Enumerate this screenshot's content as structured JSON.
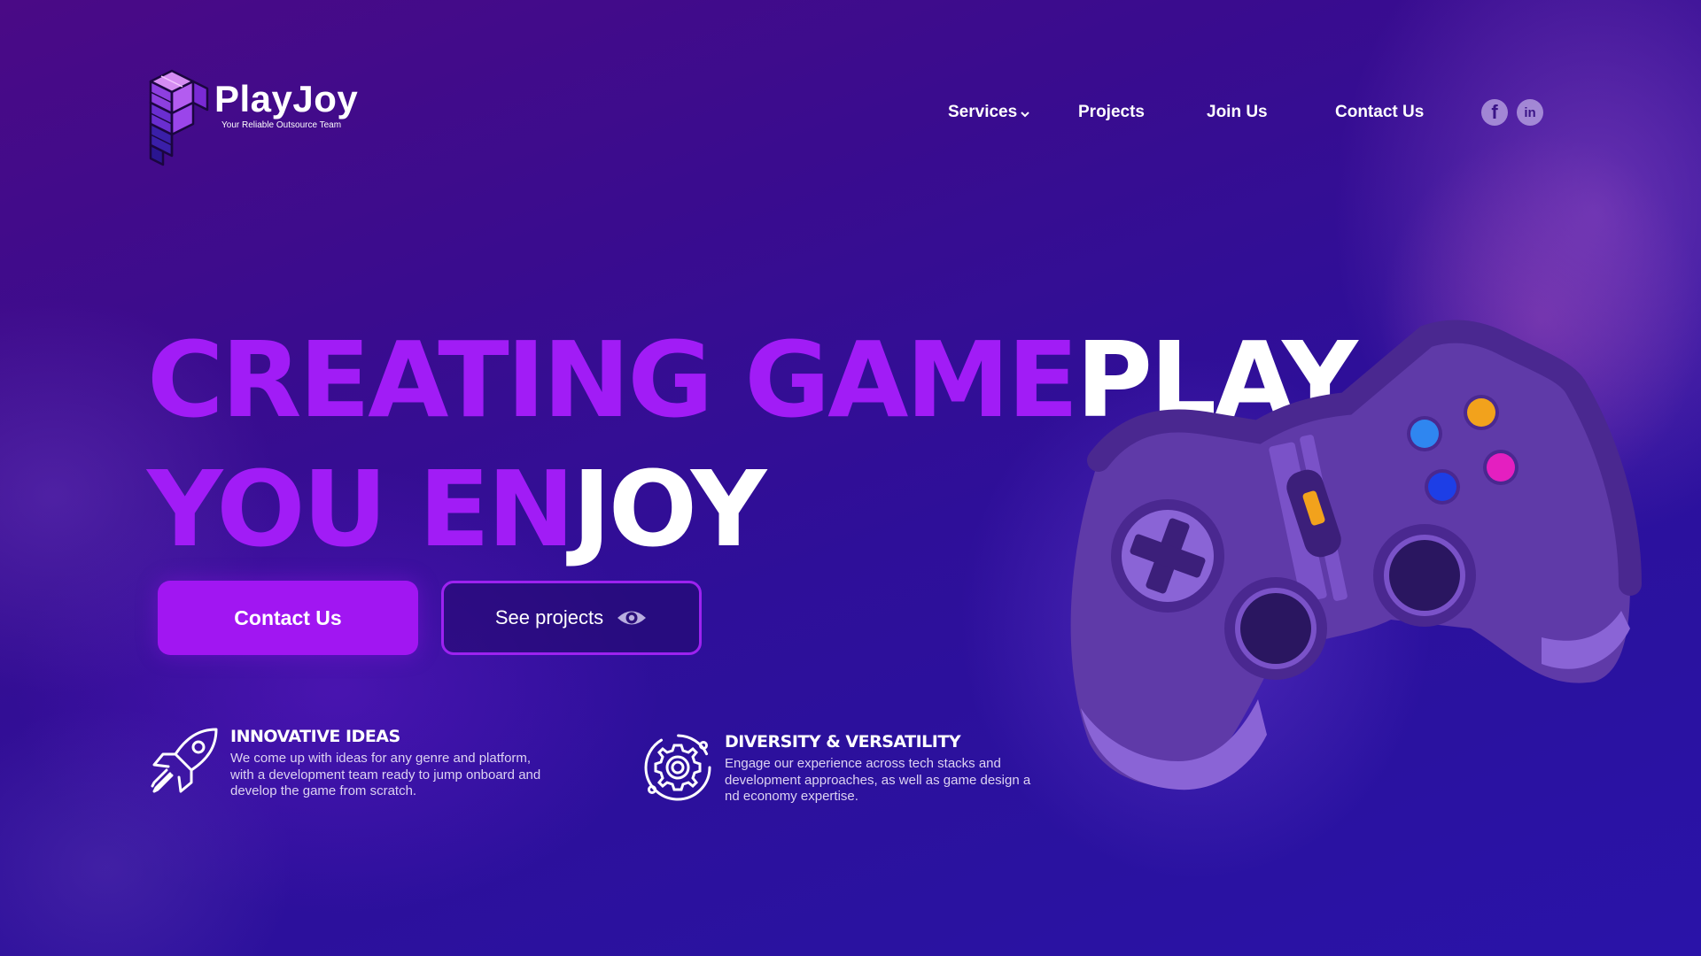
{
  "brand": {
    "name": "PlayJoy",
    "tagline": "Your Reliable  Outsource Team"
  },
  "nav": {
    "services": "Services",
    "projects": "Projects",
    "join_us": "Join Us",
    "contact_us": "Contact Us"
  },
  "social": {
    "facebook": "f",
    "linkedin": "in"
  },
  "hero": {
    "line1_purple": "CREATING GAME",
    "line1_white": "PLAY",
    "line2_purple": "YOU EN",
    "line2_white": "JOY",
    "primary_button": "Contact Us",
    "secondary_button": "See projects"
  },
  "features": [
    {
      "icon": "rocket-icon",
      "title": "INNOVATIVE IDEAS",
      "desc_lines": [
        "We come up with ideas for any genre and platform,",
        "with a development team ready to jump onboard and",
        "develop the game from scratch."
      ]
    },
    {
      "icon": "gear-icon",
      "title": "DIVERSITY & VERSATILITY",
      "desc_lines": [
        "Engage our experience across tech stacks and",
        "development approaches, as well as game design a",
        "nd economy expertise."
      ]
    }
  ],
  "colors": {
    "accent_purple": "#a11cf6",
    "button_purple": "#a116f2",
    "background_deep": "#2e0f99"
  }
}
